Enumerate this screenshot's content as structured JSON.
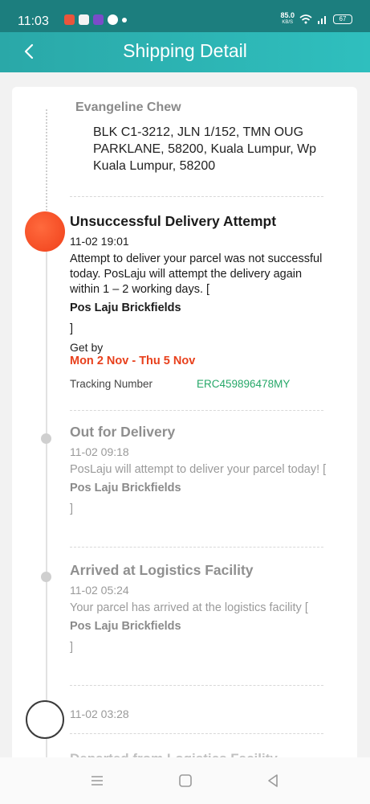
{
  "status_bar": {
    "time": "11:03",
    "net_speed": "85.0",
    "net_unit": "KB/S",
    "battery": "67"
  },
  "header": {
    "title": "Shipping Detail"
  },
  "address": {
    "name": "Evangeline Chew",
    "text": "BLK C1-3212, JLN 1/152, TMN OUG PARKLANE, 58200, Kuala Lumpur, Wp Kuala Lumpur, 58200"
  },
  "events": [
    {
      "title": "Unsuccessful Delivery Attempt",
      "time": "11-02 19:01",
      "desc": "Attempt to deliver your parcel was not successful today. PosLaju will attempt the delivery again within 1 – 2 working days. [",
      "location": "Pos Laju Brickfields",
      "close": "]"
    },
    {
      "title": "Out for Delivery",
      "time": "11-02 09:18",
      "desc": "PosLaju will attempt to deliver your parcel today! [",
      "location": "Pos Laju Brickfields",
      "close": "]"
    },
    {
      "title": "Arrived at Logistics Facility",
      "time": "11-02 05:24",
      "desc": "Your parcel has arrived at the logistics facility [",
      "location": "Pos Laju Brickfields",
      "close": "]"
    },
    {
      "time": "11-02 03:28"
    },
    {
      "title": "Departed from Logistics Facility"
    }
  ],
  "get_by": {
    "label": "Get by",
    "dates": "Mon 2 Nov - Thu 5 Nov"
  },
  "tracking": {
    "label": "Tracking Number",
    "number": "ERC459896478MY"
  },
  "colors": {
    "status_bar": "#1c7e7e",
    "header": "#2fb3b2",
    "active_dot": "#f0401a",
    "get_by_dates": "#e8401c",
    "tracking_number": "#27a869"
  }
}
